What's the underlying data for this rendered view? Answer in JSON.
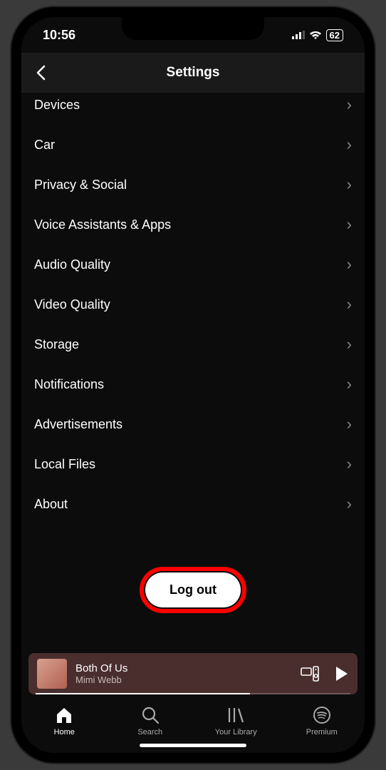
{
  "status": {
    "time": "10:56",
    "battery": "62"
  },
  "header": {
    "title": "Settings"
  },
  "settings": {
    "items": [
      "Devices",
      "Car",
      "Privacy & Social",
      "Voice Assistants & Apps",
      "Audio Quality",
      "Video Quality",
      "Storage",
      "Notifications",
      "Advertisements",
      "Local Files",
      "About"
    ]
  },
  "logout": {
    "label": "Log out"
  },
  "nowPlaying": {
    "title": "Both Of Us",
    "artist": "Mimi Webb"
  },
  "tabs": {
    "home": "Home",
    "search": "Search",
    "library": "Your Library",
    "premium": "Premium"
  }
}
